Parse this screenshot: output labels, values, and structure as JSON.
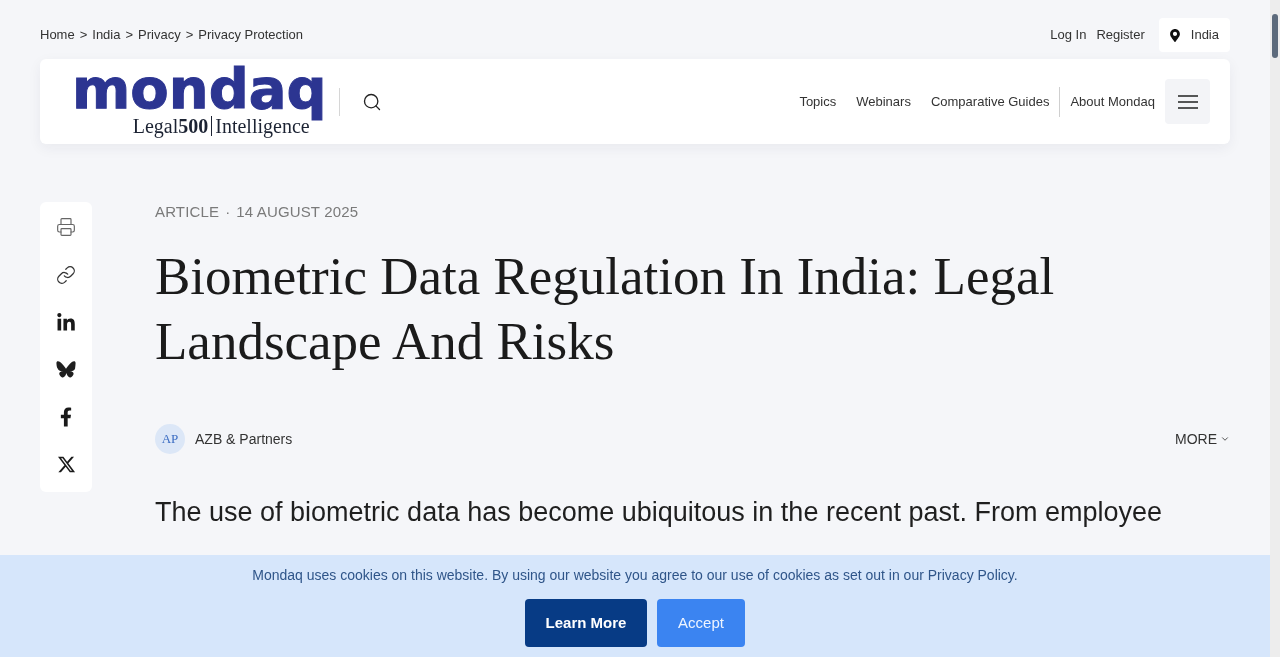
{
  "breadcrumb": {
    "items": [
      "Home",
      "India",
      "Privacy",
      "Privacy Protection"
    ],
    "separators": [
      ">",
      ">",
      ">"
    ]
  },
  "account_links": [
    "Log In",
    "Register"
  ],
  "region_button": {
    "label": "India"
  },
  "header": {
    "logo": {
      "wordmark": "mondaq",
      "tagline": "Legal**500**",
      "suffix": "Intelligence"
    },
    "nav": [
      "Topics",
      "Webinars",
      "Comparative Guides"
    ],
    "about_link": "About Mondaq"
  },
  "article": {
    "type": "ARTICLE",
    "separator": "·",
    "date": "14 AUGUST 2025",
    "title": "Biometric Data Regulation In India: Legal Landscape And Risks",
    "author": {
      "initials": "AP",
      "name": "AZB & Partners"
    },
    "more": "MORE",
    "lead": "The use of biometric data has become ubiquitous in the recent past. From employee"
  },
  "cookie_banner": {
    "message": "Mondaq uses cookies on this website. By using our website you agree to our use of cookies as set out in our Privacy Policy.",
    "buttons": [
      {
        "label": "Learn More",
        "kind": "primary"
      },
      {
        "label": "Accept",
        "kind": "secondary"
      }
    ]
  }
}
